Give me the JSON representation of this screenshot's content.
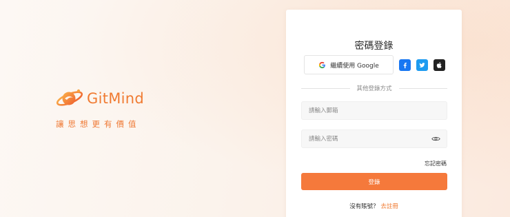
{
  "brand": {
    "name": "GitMind",
    "slogan": "讓思想更有價值"
  },
  "login": {
    "title": "密碼登錄",
    "google_label": "繼續使用 Google",
    "divider_text": "其他登錄方式",
    "email_placeholder": "請輸入郵箱",
    "password_placeholder": "請輸入密碼",
    "forgot_label": "忘記密碼",
    "submit_label": "登錄",
    "no_account_text": "沒有賬號？",
    "signup_label": "去註冊"
  },
  "social_icons": [
    "google-icon",
    "facebook-icon",
    "twitter-icon",
    "apple-icon"
  ],
  "colors": {
    "accent": "#f5793b",
    "brand": "#f07b32",
    "facebook": "#1877f2",
    "twitter": "#1d9bf0",
    "apple": "#222222"
  }
}
